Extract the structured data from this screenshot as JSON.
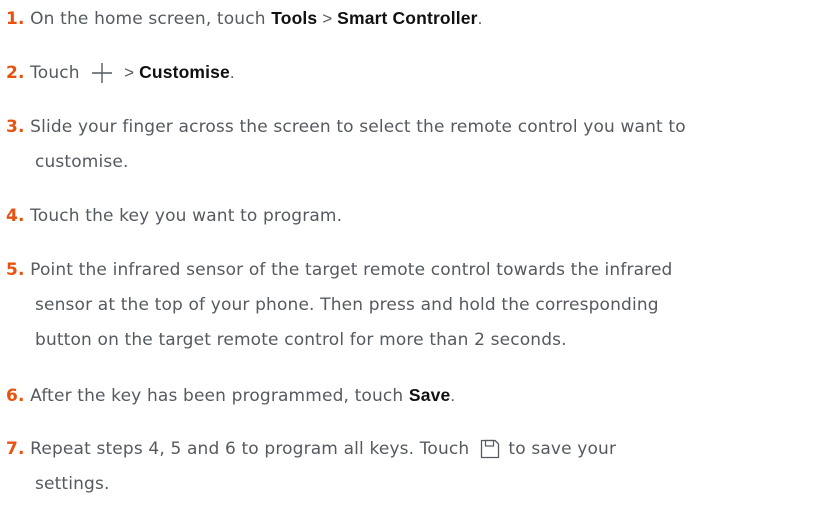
{
  "steps": [
    {
      "number": "1.",
      "text_a": "On the home screen, touch ",
      "bold_a": "Tools",
      "sep": " > ",
      "bold_b": "Smart Controller",
      "text_end": "."
    },
    {
      "number": "2.",
      "text_a": "Touch ",
      "icon": "plus-icon",
      "sep": " > ",
      "bold_a": "Customise",
      "text_end": "."
    },
    {
      "number": "3.",
      "line1": "Slide your finger across the screen to select the remote control you want to",
      "line2": "customise."
    },
    {
      "number": "4.",
      "text": "Touch the key you want to program."
    },
    {
      "number": "5.",
      "line1": "Point the infrared sensor of the target remote control towards the infrared",
      "line2": "sensor at the top of your phone. Then press and hold the corresponding",
      "line3": "button on the target remote control for more than 2 seconds."
    },
    {
      "number": "6.",
      "text_a": "After the key has been programmed, touch ",
      "bold_a": "Save",
      "text_end": "."
    },
    {
      "number": "7.",
      "text_a": "Repeat steps 4, 5 and 6 to program all keys. Touch ",
      "icon": "save-icon",
      "text_b": " to save your",
      "line2": "settings."
    }
  ],
  "colors": {
    "number": "#e8520f",
    "body_text": "#555a60",
    "bold_text": "#111111"
  }
}
